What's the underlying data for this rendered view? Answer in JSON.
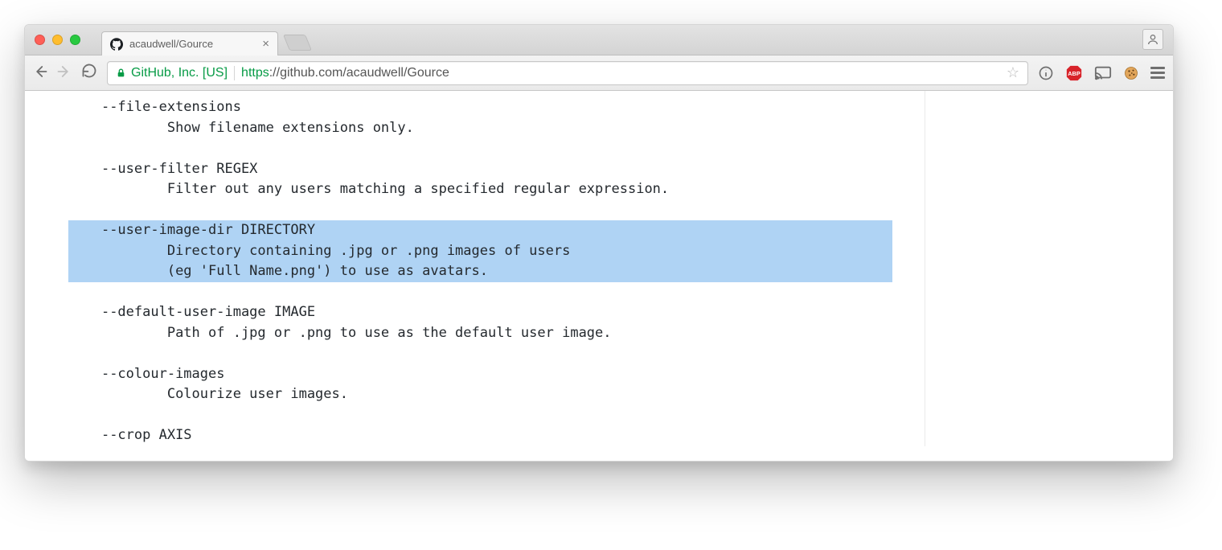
{
  "window": {
    "tab_title": "acaudwell/Gource"
  },
  "address": {
    "cert_identity": "GitHub, Inc. [US]",
    "proto": "https",
    "host_path": "://github.com/acaudwell/Gource"
  },
  "doc": {
    "opt1_flag": "--file-extensions",
    "opt1_desc": "Show filename extensions only.",
    "opt2_flag": "--user-filter REGEX",
    "opt2_desc": "Filter out any users matching a specified regular expression.",
    "opt3_flag": "--user-image-dir DIRECTORY",
    "opt3_desc_a": "Directory containing .jpg or .png images of users",
    "opt3_desc_b": "(eg 'Full Name.png') to use as avatars.",
    "opt4_flag": "--default-user-image IMAGE",
    "opt4_desc": "Path of .jpg or .png to use as the default user image.",
    "opt5_flag": "--colour-images",
    "opt5_desc": "Colourize user images.",
    "opt6_flag": "--crop AXIS"
  }
}
